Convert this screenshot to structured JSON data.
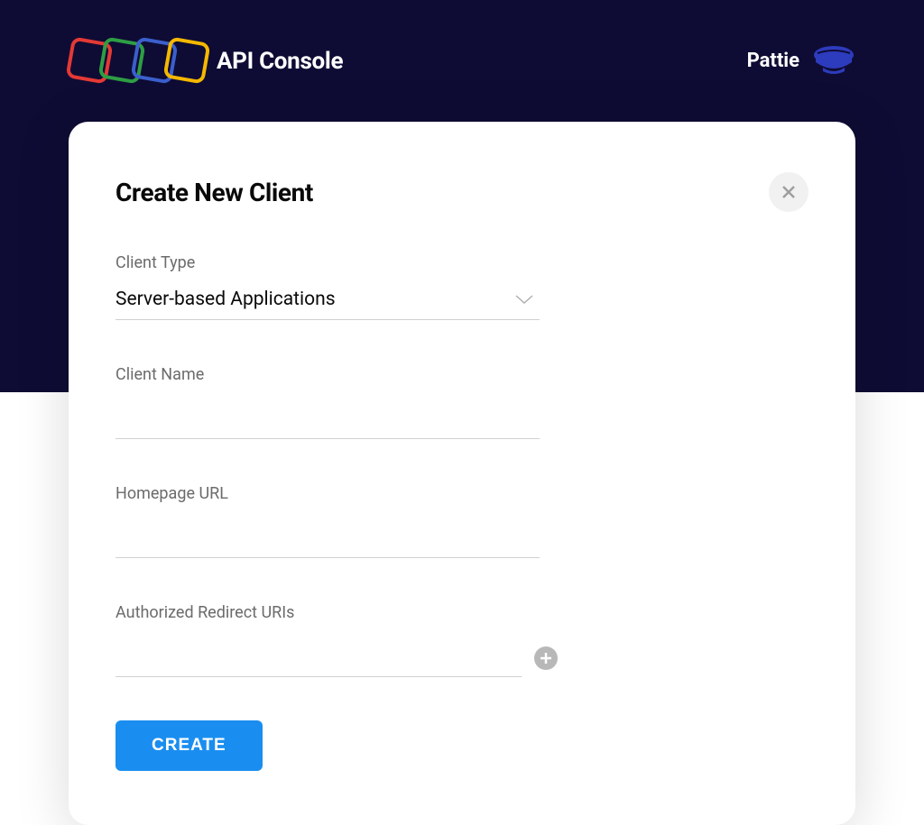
{
  "header": {
    "app_title": "API Console",
    "user_name": "Pattie"
  },
  "card": {
    "title": "Create New Client",
    "close_label": "Close"
  },
  "form": {
    "client_type": {
      "label": "Client Type",
      "selected": "Server-based Applications"
    },
    "client_name": {
      "label": "Client Name",
      "value": ""
    },
    "homepage_url": {
      "label": "Homepage URL",
      "value": ""
    },
    "redirect_uris": {
      "label": "Authorized Redirect URIs",
      "value": ""
    },
    "submit_label": "CREATE"
  },
  "colors": {
    "header_bg": "#0e0c34",
    "primary_button": "#1a8ef0",
    "avatar": "#2d3bbd"
  }
}
